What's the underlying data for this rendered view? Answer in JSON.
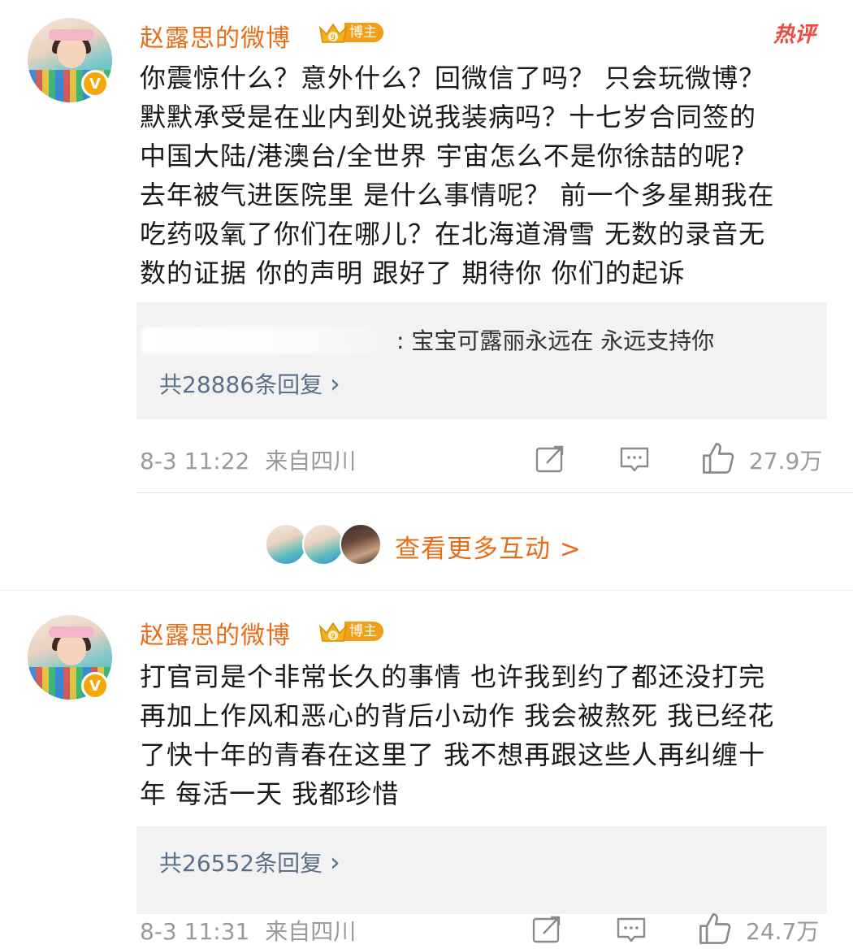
{
  "comments": [
    {
      "username": "赵露思的微博",
      "badge_label": "博主",
      "hot_tag": "热评",
      "body_lines": [
        "你震惊什么？意外什么？回微信了吗？ 只会玩微博？",
        "默默承受是在业内到处说我装病吗？十七岁合同签的",
        "中国大陆/港澳台/全世界  宇宙怎么不是你徐喆的呢?",
        "去年被气进医院里 是什么事情呢？ 前一个多星期我在",
        "吃药吸氧了你们在哪儿？在北海道滑雪 无数的录音无",
        "数的证据 你的声明 跟好了 期待你 你们的起诉"
      ],
      "reply_preview": ": 宝宝可露丽永远在 永远支持你",
      "reply_count": "共28886条回复 ",
      "reply_chevron": "›",
      "date": "8-3 11:22",
      "location": "来自四川",
      "likes": "27.9万"
    },
    {
      "username": "赵露思的微博",
      "badge_label": "博主",
      "body_lines": [
        "打官司是个非常长久的事情 也许我到约了都还没打完",
        "再加上作风和恶心的背后小动作 我会被熬死 我已经花",
        "了快十年的青春在这里了 我不想再跟这些人再纠缠十",
        "年 每活一天 我都珍惜"
      ],
      "reply_count": "共26552条回复 ",
      "reply_chevron": "›",
      "date": "8-3 11:31",
      "location": "来自四川",
      "likes": "24.7万"
    }
  ],
  "interactions": {
    "label": "查看更多互动 >"
  },
  "verified_mark": "V",
  "colors": {
    "accent_orange": "#e96d19",
    "reply_link": "#5a6f8c",
    "hot_red": "#f2473c",
    "badge_gold": "#f0a018"
  }
}
